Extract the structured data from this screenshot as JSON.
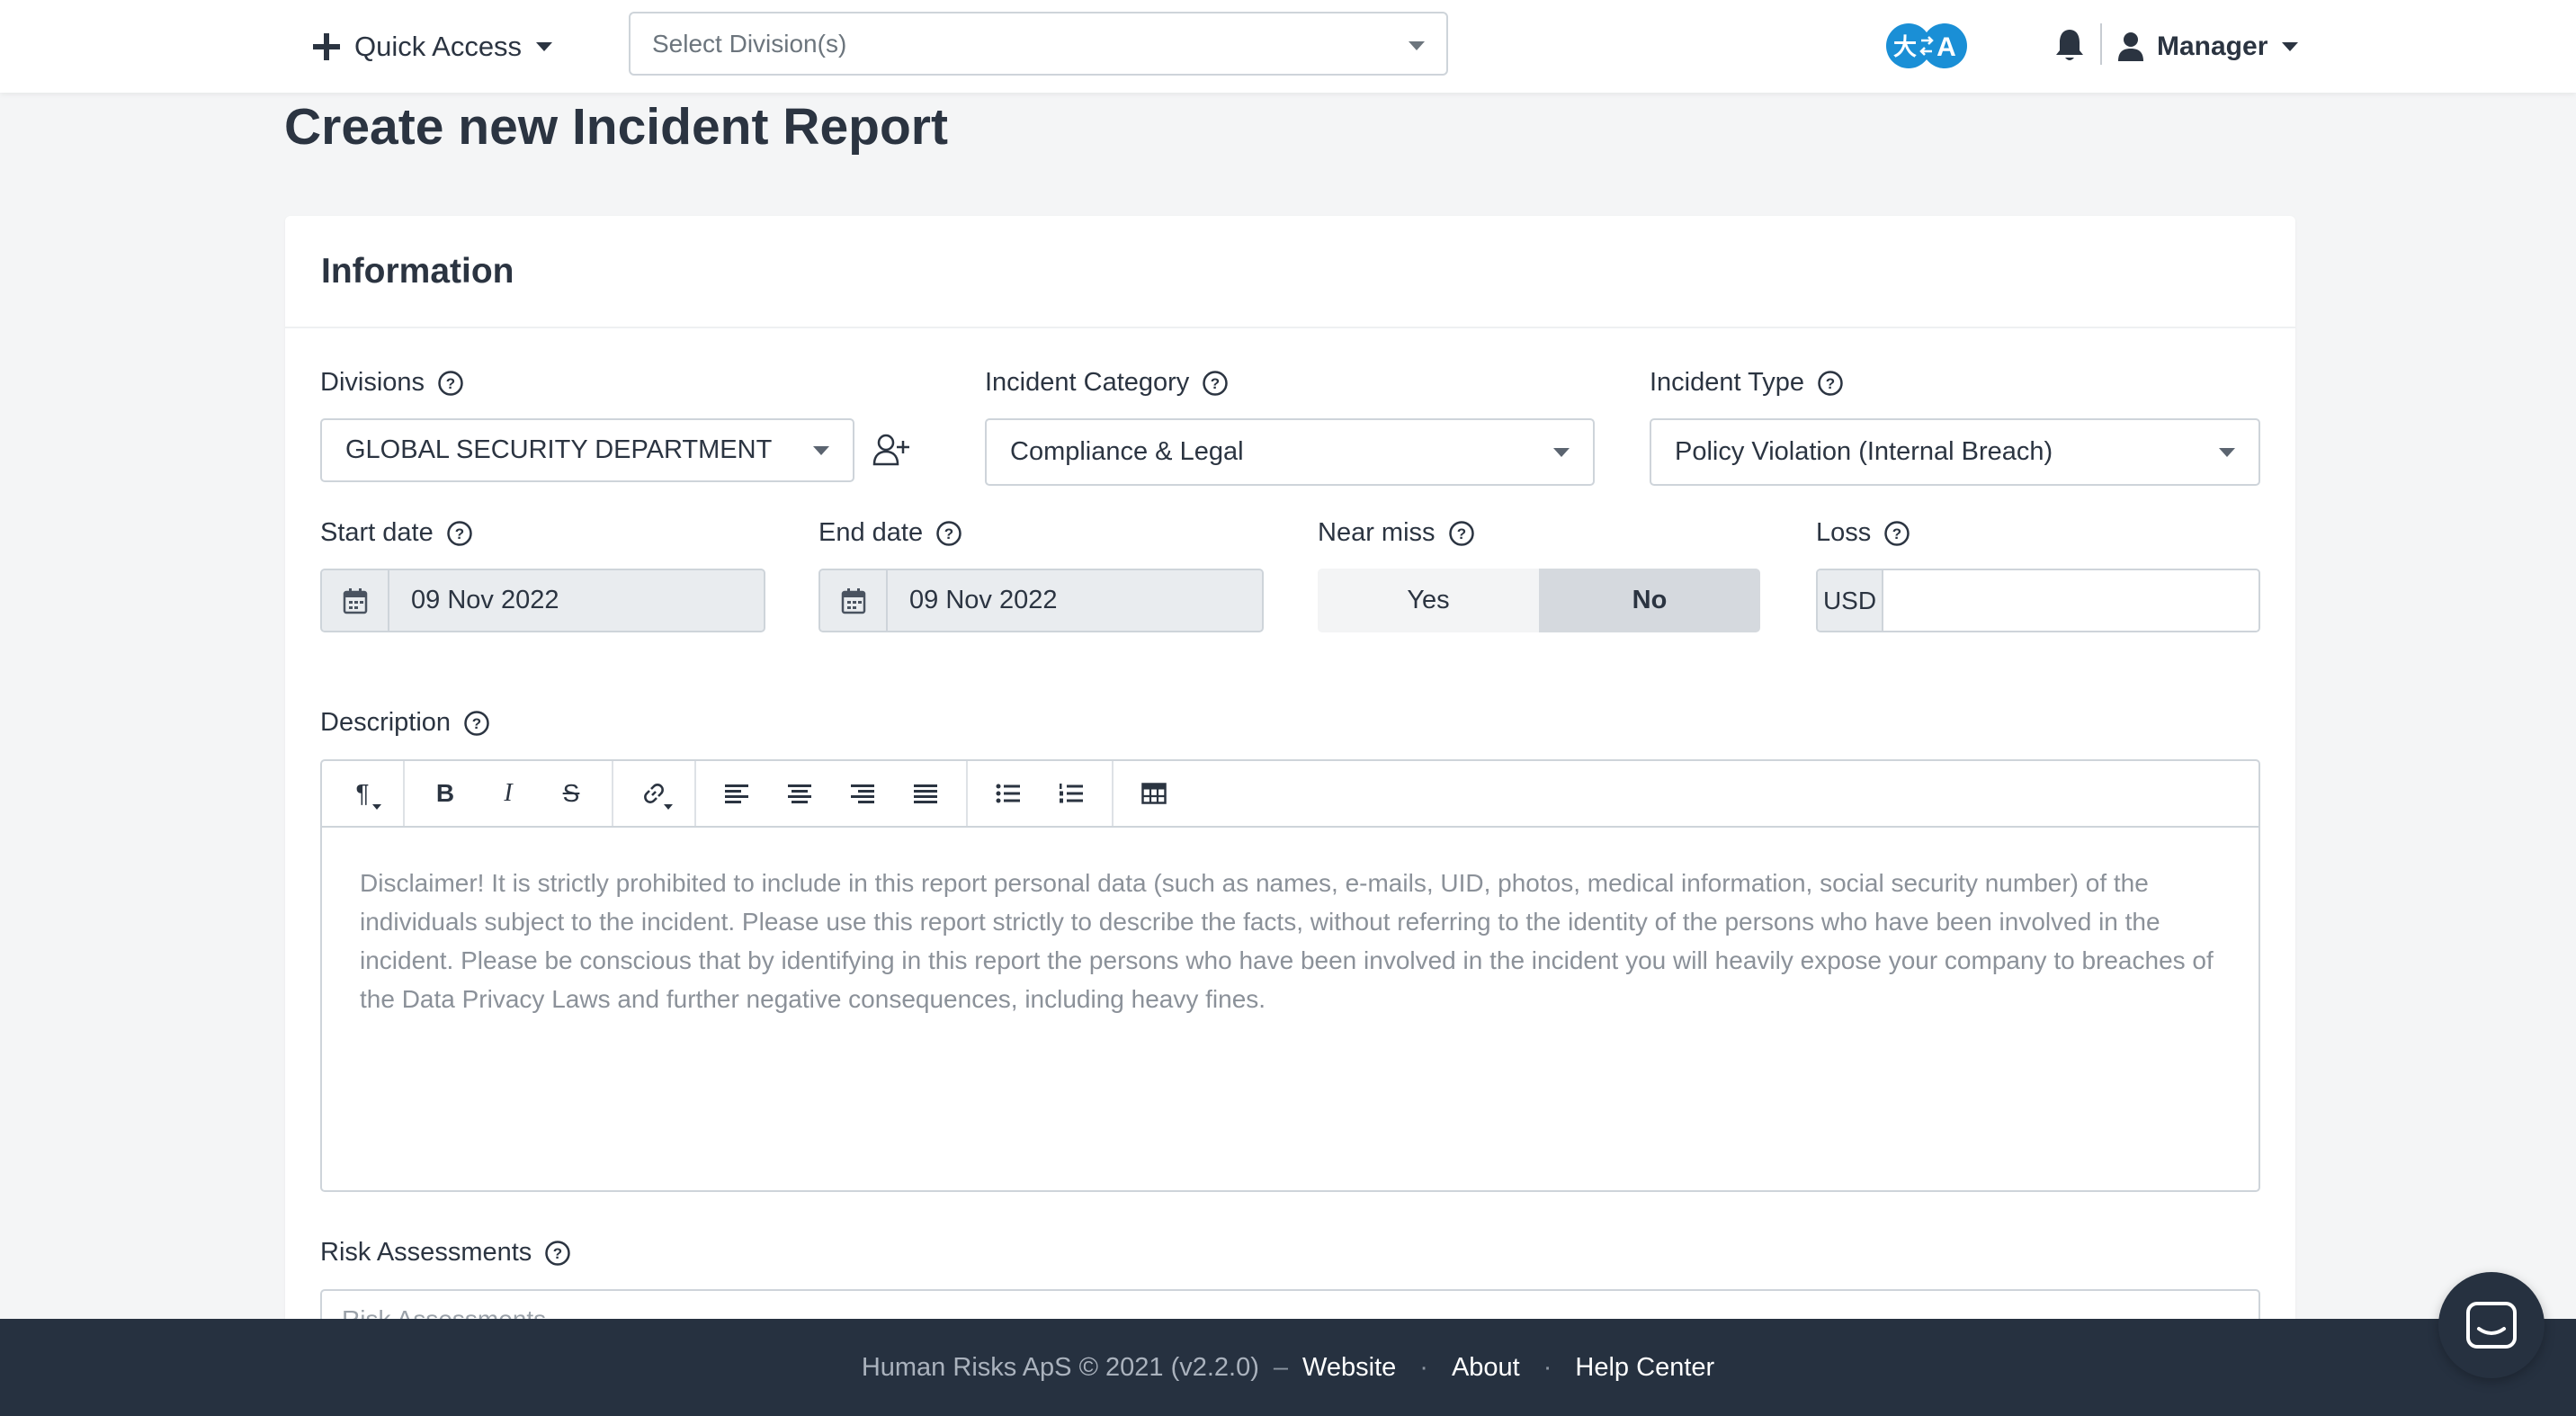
{
  "topbar": {
    "quick_access_label": "Quick Access",
    "division_placeholder": "Select Division(s)",
    "language_icon": "translate-icon",
    "user_label": "Manager"
  },
  "page": {
    "title": "Create new Incident Report"
  },
  "form": {
    "section_title": "Information",
    "divisions": {
      "label": "Divisions",
      "value": "GLOBAL SECURITY DEPARTMENT"
    },
    "incident_category": {
      "label": "Incident Category",
      "value": "Compliance & Legal"
    },
    "incident_type": {
      "label": "Incident Type",
      "value": "Policy Violation (Internal Breach)"
    },
    "start_date": {
      "label": "Start date",
      "value": "09 Nov 2022"
    },
    "end_date": {
      "label": "End date",
      "value": "09 Nov 2022"
    },
    "near_miss": {
      "label": "Near miss",
      "yes": "Yes",
      "no": "No",
      "selected": "No"
    },
    "loss": {
      "label": "Loss",
      "currency": "USD",
      "value": ""
    },
    "description": {
      "label": "Description",
      "placeholder": "Disclaimer! It is strictly prohibited to include in this report personal data (such as names, e-mails, UID, photos, medical information, social security number) of the individuals subject to the incident. Please use this report strictly to describe the facts, without referring to the identity of the persons who have been involved in the incident. Please be conscious that by identifying in this report the persons who have been involved in the incident you will heavily expose your company to breaches of the Data Privacy Laws and further negative consequences, including heavy fines."
    },
    "risk_assessments": {
      "label": "Risk Assessments",
      "placeholder": "Risk Assessments"
    }
  },
  "editor_toolbar": {
    "paragraph": "¶",
    "bold": "B",
    "italic": "I",
    "strike": "S"
  },
  "footer": {
    "copyright": "Human Risks ApS © 2021 (v2.2.0)",
    "dash": "–",
    "dot": "·",
    "website": "Website",
    "about": "About",
    "help_center": "Help Center"
  },
  "colors": {
    "brand_blue": "#1a8fd6",
    "footer_bg": "#263140",
    "text_dark": "#2b3441"
  }
}
